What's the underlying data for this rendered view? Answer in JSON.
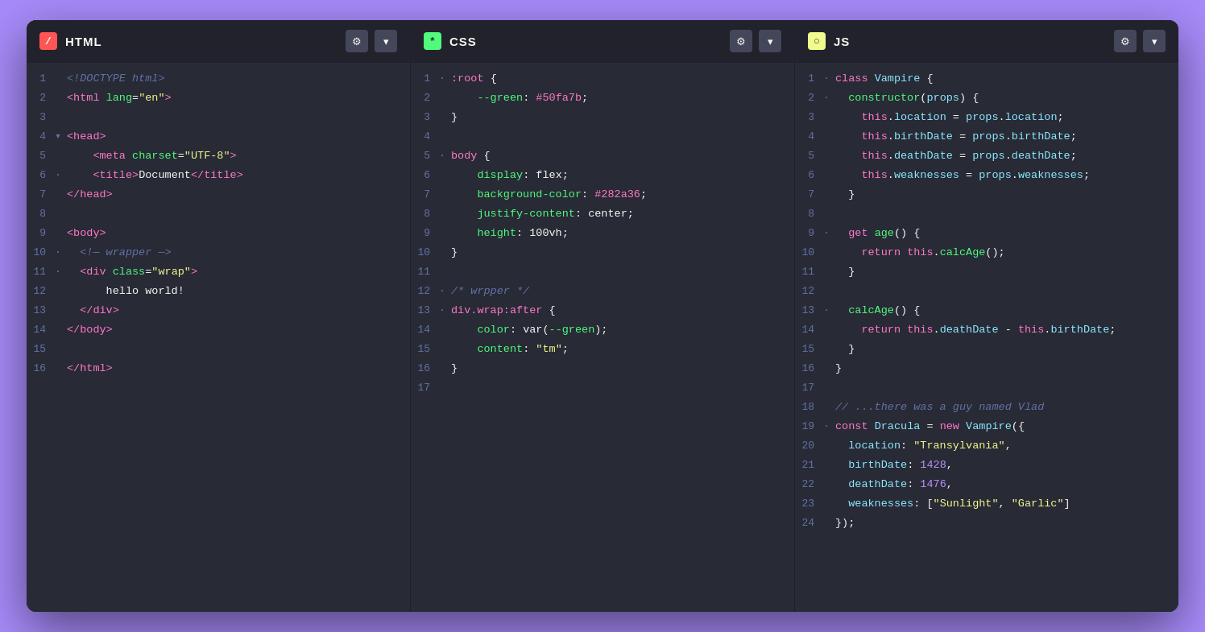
{
  "panels": [
    {
      "id": "html",
      "title": "HTML",
      "icon_type": "html",
      "icon_label": "/",
      "gear_label": "⚙",
      "chevron_label": "▾"
    },
    {
      "id": "css",
      "title": "CSS",
      "icon_type": "css",
      "icon_label": "*",
      "gear_label": "⚙",
      "chevron_label": "▾"
    },
    {
      "id": "js",
      "title": "JS",
      "icon_type": "js",
      "icon_label": "○",
      "gear_label": "⚙",
      "chevron_label": "▾"
    }
  ]
}
